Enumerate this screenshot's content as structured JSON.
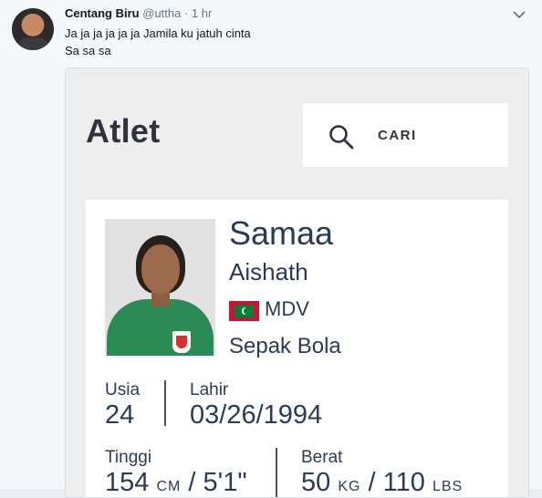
{
  "tweet": {
    "author_name": "Centang Biru",
    "meta": "@uttha · 1 hr",
    "lines": [
      "Ja ja ja ja ja ja Jamila ku jatuh cinta",
      "Sa sa sa"
    ],
    "menu_icon": "chevron-down-icon"
  },
  "page": {
    "title": "Atlet",
    "search": {
      "label": "CARI",
      "icon": "search-icon"
    }
  },
  "athlete": {
    "family_name": "Samaa",
    "given_name": "Aishath",
    "country_code": "MDV",
    "flag_colors": {
      "field": "#d21034",
      "panel": "#007e3a",
      "crescent": "#ffffff"
    },
    "sport": "Sepak Bola",
    "stats": {
      "age_label": "Usia",
      "age_value": "24",
      "birth_label": "Lahir",
      "birth_value": "03/26/1994",
      "height_label": "Tinggi",
      "height_cm": "154",
      "height_cm_unit": "CM",
      "height_sep": "/",
      "height_ft": "5'1\"",
      "weight_label": "Berat",
      "weight_kg": "50",
      "weight_kg_unit": "KG",
      "weight_sep": "/",
      "weight_lbs": "110",
      "weight_lbs_unit": "LBS"
    }
  }
}
